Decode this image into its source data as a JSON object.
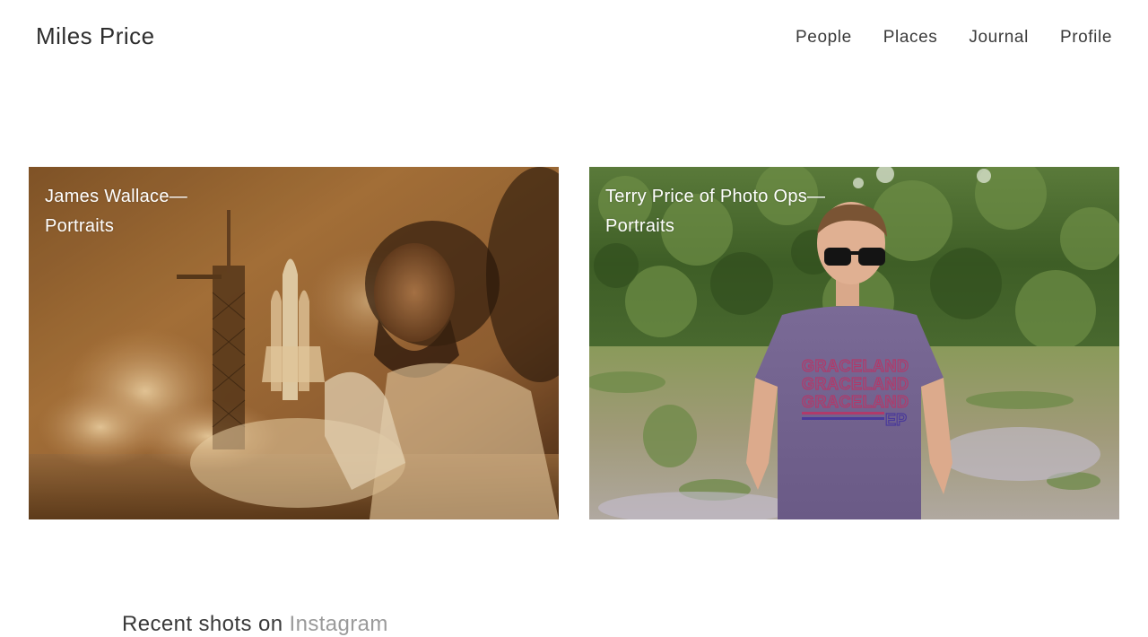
{
  "header": {
    "site_title": "Miles Price",
    "nav": [
      {
        "label": "People"
      },
      {
        "label": "Places"
      },
      {
        "label": "Journal"
      },
      {
        "label": "Profile"
      }
    ]
  },
  "cards": [
    {
      "title_line1": "James Wallace—",
      "title_line2": "Portraits",
      "photo": "space-shuttle-launch-double-exposure-portrait"
    },
    {
      "title_line1": "Terry Price of Photo Ops—",
      "title_line2": "Portraits",
      "photo": "man-in-sunglasses-graceland-tshirt"
    }
  ],
  "instagram": {
    "prefix": "Recent shots on ",
    "link": "Instagram"
  },
  "colors": {
    "text": "#2e2e2e",
    "muted_link": "#9a9a9a",
    "caption": "#ffffff"
  }
}
